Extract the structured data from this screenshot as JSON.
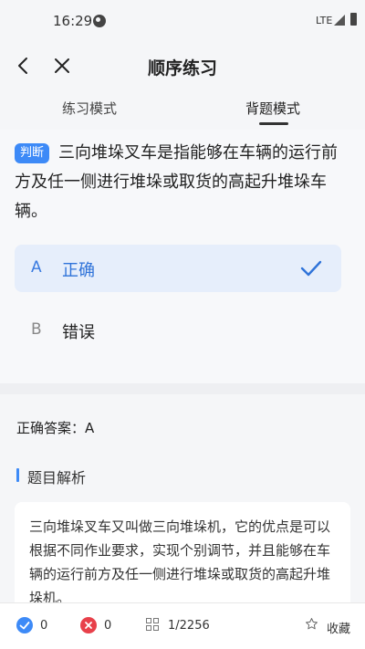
{
  "status": {
    "time": "16:29",
    "network": "LTE"
  },
  "nav": {
    "title": "顺序练习"
  },
  "tabs": [
    {
      "label": "练习模式",
      "active": false
    },
    {
      "label": "背题模式",
      "active": true
    }
  ],
  "question": {
    "badge": "判断",
    "text": "三向堆垛叉车是指能够在车辆的运行前方及任一侧进行堆垛或取货的高起升堆垛车辆。",
    "options": [
      {
        "letter": "A",
        "text": "正确",
        "selected": true
      },
      {
        "letter": "B",
        "text": "错误",
        "selected": false
      }
    ]
  },
  "answer": {
    "correct_answer": "正确答案：A",
    "analysis_title": "题目解析",
    "analysis_text": "三向堆垛叉车又叫做三向堆垛机，它的优点是可以根据不同作业要求，实现个别调节，并且能够在车辆的运行前方及任一侧进行堆垛或取货的高起升堆垛机。"
  },
  "bottom": {
    "correct_count": "0",
    "wrong_count": "0",
    "progress": "1/2256",
    "favorite_label": "收藏"
  },
  "colors": {
    "accent": "#3d8af7",
    "wrong": "#e8404a",
    "selected_bg": "#e6eefb"
  }
}
